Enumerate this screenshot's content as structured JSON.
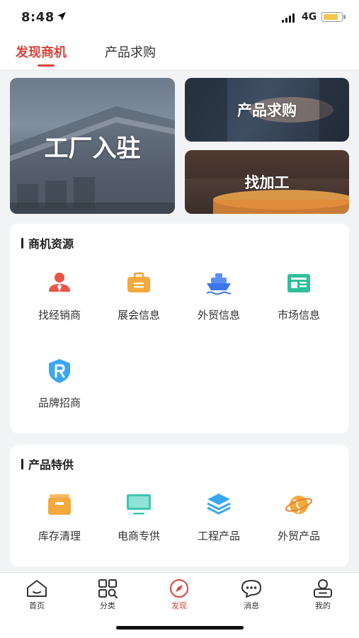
{
  "status_bar": {
    "time": "8:48",
    "network": "4G",
    "battery_percent": 85
  },
  "tabs": [
    {
      "label": "发现商机",
      "active": true
    },
    {
      "label": "产品求购",
      "active": false
    }
  ],
  "banners": {
    "factory": "工厂入驻",
    "purchase": "产品求购",
    "processing": "找加工"
  },
  "resources": {
    "title": "商机资源",
    "items": [
      {
        "label": "找经销商",
        "icon": "person-icon"
      },
      {
        "label": "展会信息",
        "icon": "briefcase-icon"
      },
      {
        "label": "外贸信息",
        "icon": "ship-icon"
      },
      {
        "label": "市场信息",
        "icon": "newspaper-icon"
      },
      {
        "label": "品牌招商",
        "icon": "brand-shield-icon"
      }
    ]
  },
  "products": {
    "title": "产品特供",
    "items": [
      {
        "label": "库存清理",
        "icon": "inventory-box-icon"
      },
      {
        "label": "电商专供",
        "icon": "monitor-icon"
      },
      {
        "label": "工程产品",
        "icon": "layers-icon"
      },
      {
        "label": "外贸产品",
        "icon": "globe-icon"
      }
    ]
  },
  "bottom_nav": [
    {
      "label": "首页",
      "icon": "home-icon"
    },
    {
      "label": "分类",
      "icon": "category-icon"
    },
    {
      "label": "发现",
      "icon": "compass-icon",
      "active": true
    },
    {
      "label": "消息",
      "icon": "message-icon"
    },
    {
      "label": "我的",
      "icon": "profile-icon"
    }
  ],
  "colors": {
    "accent": "#d9443a",
    "background": "#f2f3f5"
  }
}
